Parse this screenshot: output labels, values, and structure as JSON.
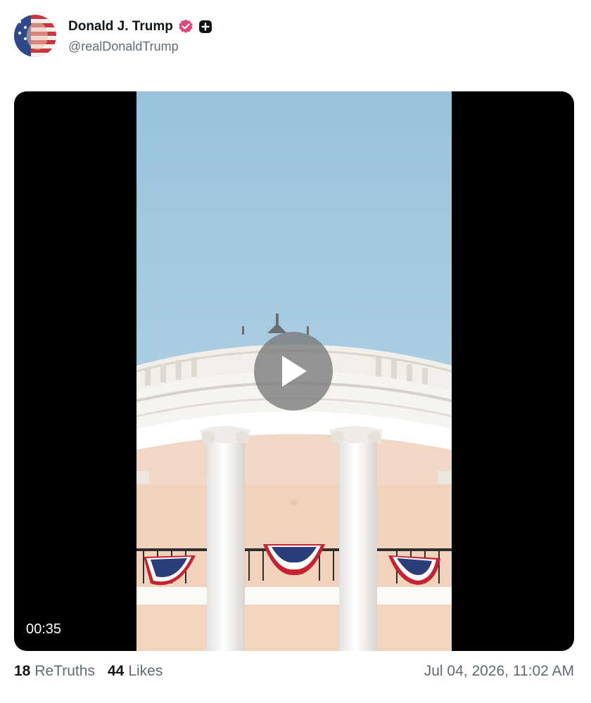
{
  "post": {
    "display_name": "Donald J. Trump",
    "handle": "@realDonaldTrump",
    "verified_icon": "verified-badge-icon",
    "plus_icon": "plus-badge-icon",
    "accent_color": "#e5467a"
  },
  "media": {
    "duration": "00:35",
    "play_icon": "play-icon"
  },
  "stats": {
    "retruths_count": "18",
    "retruths_label": "ReTruths",
    "likes_count": "44",
    "likes_label": "Likes"
  },
  "timestamp": "Jul 04, 2026, 11:02 AM"
}
